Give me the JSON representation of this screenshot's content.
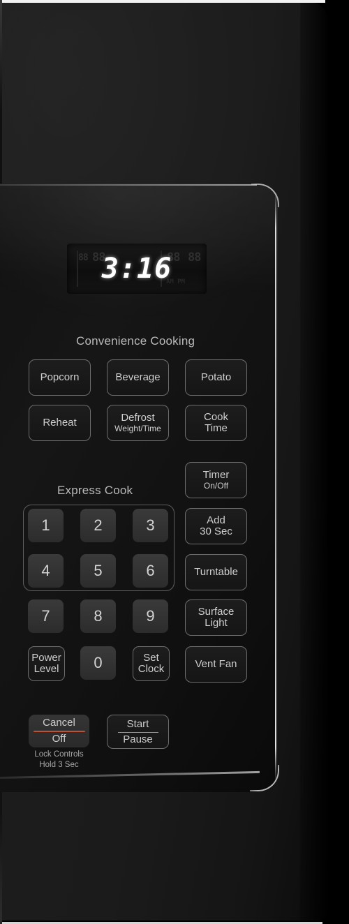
{
  "appliance": {
    "type": "over-the-range-microwave-control-panel",
    "finish_color": "#1b1b1b",
    "panel_color": "#121212",
    "accent_color": "#bd5038",
    "label_color": "#cfcfcf"
  },
  "display": {
    "time": "3:16",
    "dim_left_1": "88",
    "dim_left_2": "88",
    "dim_right_1": "88",
    "dim_right_2": "88",
    "dim_ampm": "AM PM",
    "color": "#ffffff"
  },
  "sections": {
    "convenience_title": "Convenience Cooking",
    "express_title": "Express Cook"
  },
  "convenience_buttons": [
    {
      "label": "Popcorn",
      "sub": ""
    },
    {
      "label": "Beverage",
      "sub": ""
    },
    {
      "label": "Potato",
      "sub": ""
    },
    {
      "label": "Reheat",
      "sub": ""
    },
    {
      "label": "Defrost",
      "sub": "Weight/Time"
    },
    {
      "label": "Cook",
      "sub": "Time",
      "two_line": true
    }
  ],
  "number_keys": [
    {
      "label": "1"
    },
    {
      "label": "2"
    },
    {
      "label": "3"
    },
    {
      "label": "4"
    },
    {
      "label": "5"
    },
    {
      "label": "6"
    },
    {
      "label": "7"
    },
    {
      "label": "8"
    },
    {
      "label": "9"
    },
    {
      "label": "0"
    }
  ],
  "function_buttons": {
    "timer": {
      "line1": "Timer",
      "line2": "On/Off"
    },
    "add30": {
      "line1": "Add",
      "line2": "30 Sec"
    },
    "turntable": {
      "line1": "Turntable",
      "line2": ""
    },
    "surface_light": {
      "line1": "Surface",
      "line2": "Light"
    },
    "vent_fan": {
      "line1": "Vent Fan",
      "line2": ""
    },
    "power_level": {
      "line1": "Power",
      "line2": "Level"
    },
    "set_clock": {
      "line1": "Set",
      "line2": "Clock"
    }
  },
  "action_buttons": {
    "cancel": {
      "line1": "Cancel",
      "line2": "Off",
      "divider_color": "#bd5038"
    },
    "start": {
      "line1": "Start",
      "line2": "Pause",
      "divider_color": "#9a9a9a"
    }
  },
  "lock_caption": {
    "line1": "Lock Controls",
    "line2": "Hold 3 Sec"
  }
}
